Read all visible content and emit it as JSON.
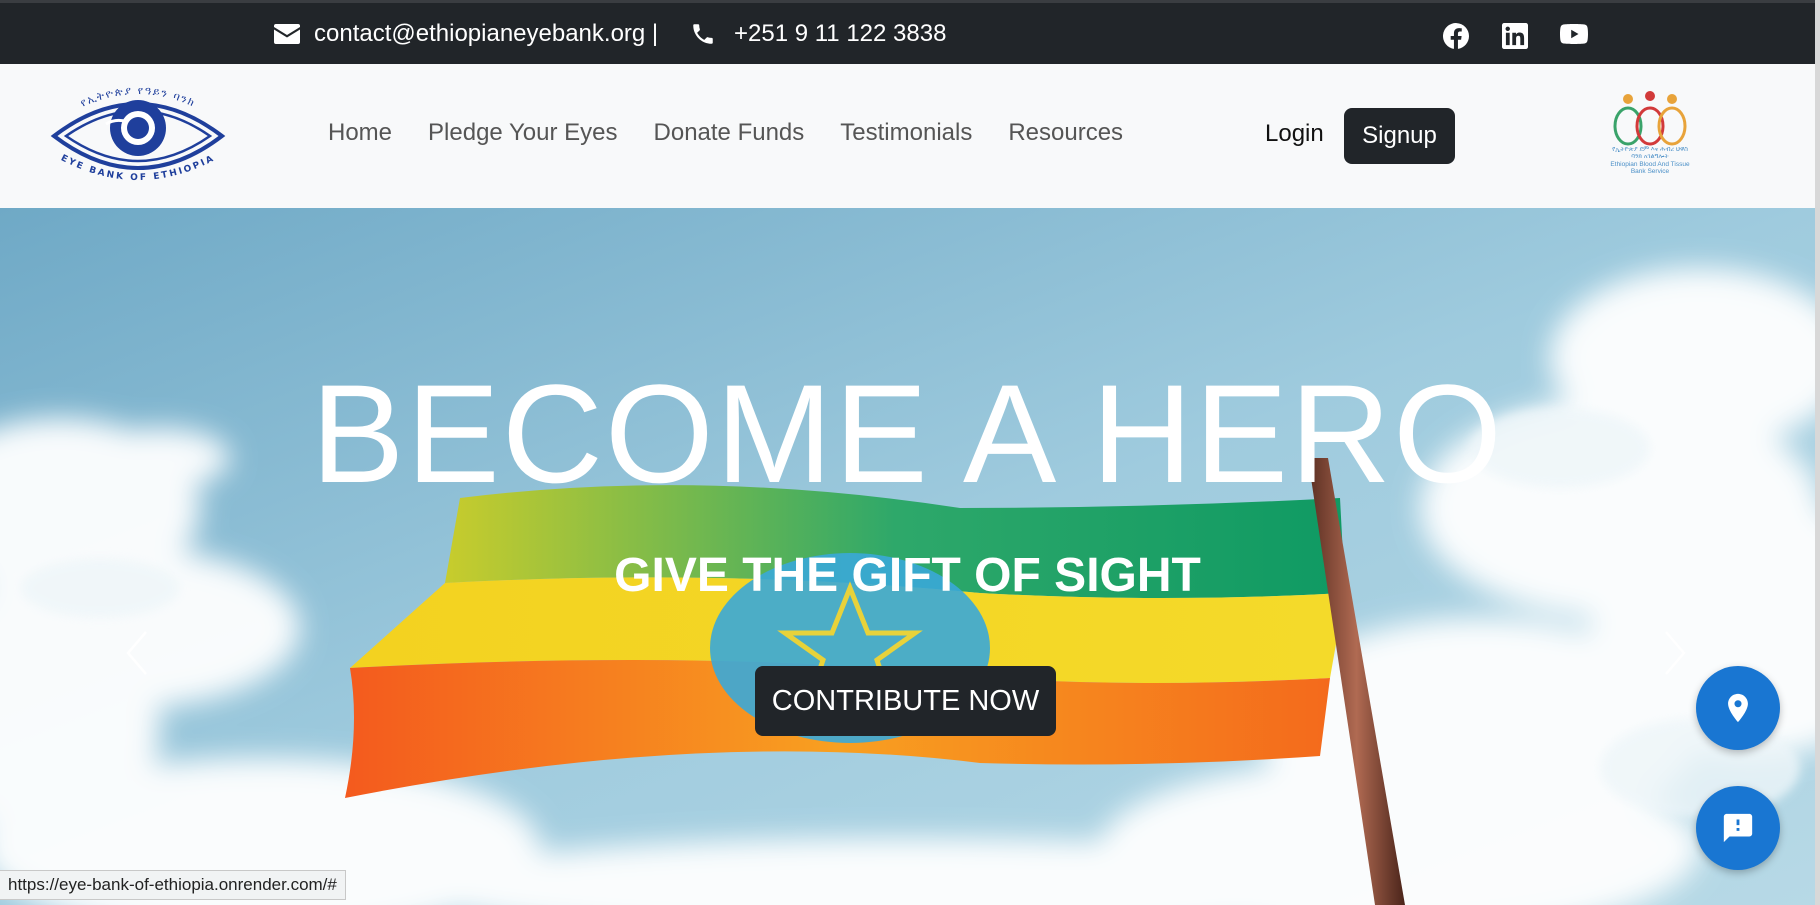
{
  "topbar": {
    "email": "contact@ethiopianeyebank.org |",
    "phone": "+251 9 11 122 3838",
    "social": [
      "facebook-icon",
      "linkedin-icon",
      "youtube-icon"
    ]
  },
  "navbar": {
    "logo_left_text": "የኢትዮጵያ የዓይን ባንክ",
    "logo_left_subtext": "EYE BANK OF ETHIOPIA",
    "links": [
      "Home",
      "Pledge Your Eyes",
      "Donate Funds",
      "Testimonials",
      "Resources"
    ],
    "login": "Login",
    "signup": "Signup",
    "logo_right_text_1": "የኢትዮጵያ ደም እና ሕብረ ህዋስ",
    "logo_right_text_2": "ባንክ አገልግሎት",
    "logo_right_text_3": "Ethiopian Blood And Tissue",
    "logo_right_text_4": "Bank Service"
  },
  "hero": {
    "headline": "BECOME A HERO",
    "subheadline": "GIVE THE GIFT OF SIGHT",
    "cta": "CONTRIBUTE NOW"
  },
  "status_url": "https://eye-bank-of-ethiopia.onrender.com/#",
  "colors": {
    "dark": "#212529",
    "navbar_bg": "#f8f9fa",
    "fab_blue": "#1976d2",
    "logo_blue": "#1f3f9c"
  }
}
